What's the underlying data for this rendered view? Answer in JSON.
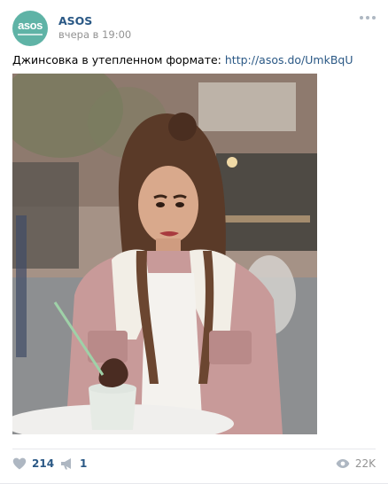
{
  "post": {
    "author": "ASOS",
    "time": "вчера в 19:00",
    "text_prefix": "Джинсовка в утепленном формате: ",
    "link": "http://asos.do/UmkBqU",
    "avatar_logo": "asos",
    "icon_more": "more-dots-icon"
  },
  "actions": {
    "likes": "214",
    "shares": "1",
    "views": "22K",
    "icons": [
      "heart-icon",
      "share-megaphone-icon",
      "eye-icon"
    ]
  },
  "colors": {
    "link": "#2a5885",
    "muted": "#939393",
    "avatar_bg": "#5fb3a6",
    "icon": "#aeb7c2"
  }
}
